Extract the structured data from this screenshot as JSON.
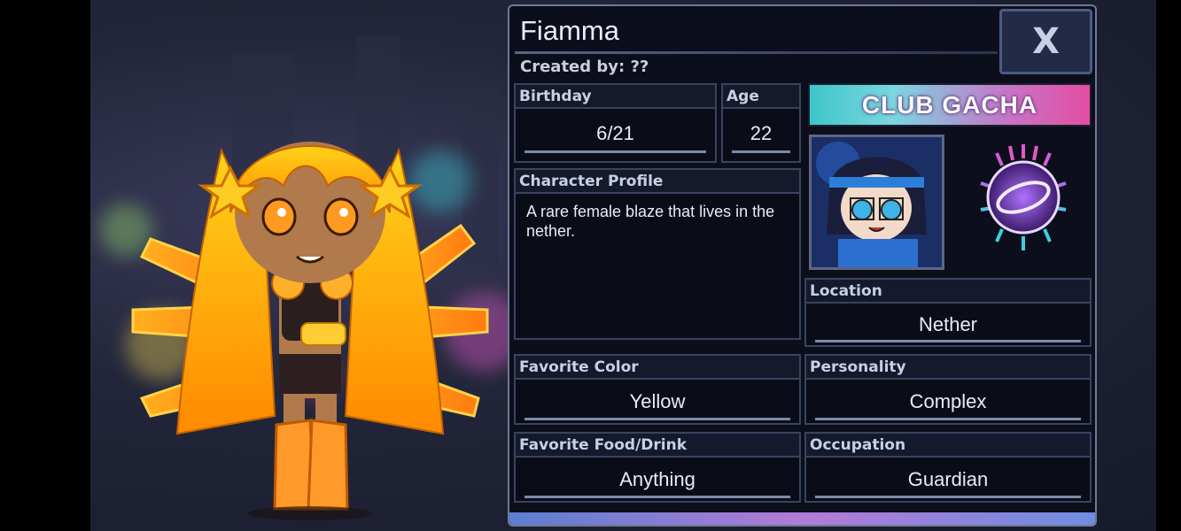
{
  "profile": {
    "name": "Fiamma",
    "created_by": "Created by: ??",
    "close_label": "X"
  },
  "fields": {
    "birthday": {
      "label": "Birthday",
      "value": "6/21"
    },
    "age": {
      "label": "Age",
      "value": "22"
    },
    "character_profile": {
      "label": "Character Profile",
      "value": "A rare female blaze that lives in the nether."
    },
    "location": {
      "label": "Location",
      "value": "Nether"
    },
    "favorite_color": {
      "label": "Favorite Color",
      "value": "Yellow"
    },
    "personality": {
      "label": "Personality",
      "value": "Complex"
    },
    "favorite_food": {
      "label": "Favorite Food/Drink",
      "value": "Anything"
    },
    "occupation": {
      "label": "Occupation",
      "value": "Guardian"
    }
  },
  "brand": {
    "name": "CLUB GACHA"
  },
  "colors": {
    "panel_bg": "#0c0f1b",
    "panel_border": "#6f7895",
    "hair": "#ffc400",
    "sword": "#ff9d1f"
  }
}
